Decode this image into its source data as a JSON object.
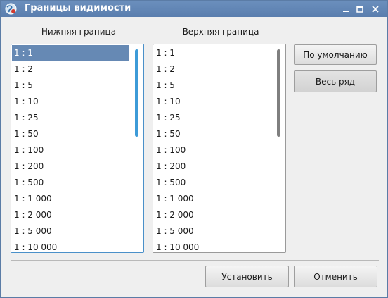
{
  "window": {
    "title": "Границы видимости",
    "controls": {
      "minimize": "_",
      "maximize": "□",
      "close": "×"
    }
  },
  "lower": {
    "label": "Нижняя граница",
    "selected": "1 : 1",
    "scrollbar_color": "#3d9bd8",
    "items": [
      "1 : 1",
      "1 : 2",
      "1 : 5",
      "1 : 10",
      "1 : 25",
      "1 : 50",
      "1 : 100",
      "1 : 200",
      "1 : 500",
      "1 : 1 000",
      "1 : 2 000",
      "1 : 5 000",
      "1 : 10 000"
    ]
  },
  "upper": {
    "label": "Верхняя граница",
    "scrollbar_color": "#7f7f7f",
    "items": [
      "1 : 1",
      "1 : 2",
      "1 : 5",
      "1 : 10",
      "1 : 25",
      "1 : 50",
      "1 : 100",
      "1 : 200",
      "1 : 500",
      "1 : 1 000",
      "1 : 2 000",
      "1 : 5 000",
      "1 : 10 000"
    ]
  },
  "side_buttons": {
    "default": "По умолчанию",
    "full_range": "Весь ряд"
  },
  "footer": {
    "apply": "Установить",
    "cancel": "Отменить"
  },
  "colors": {
    "titlebar": "#5a7eae",
    "selection": "#6689b4",
    "focus_border": "#4a90c9"
  }
}
